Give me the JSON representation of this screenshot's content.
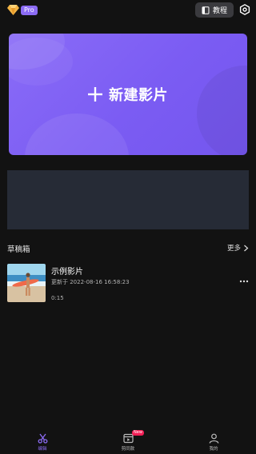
{
  "header": {
    "vip_badge": "Pro",
    "tutorial_label": "教程"
  },
  "create": {
    "label": "新建影片"
  },
  "drafts": {
    "section_title": "草稿箱",
    "more_label": "更多",
    "items": [
      {
        "title": "示例影片",
        "updated": "更新于 2022-08-16 16:58:23",
        "duration": "0:15"
      }
    ]
  },
  "tabbar": {
    "tabs": [
      {
        "label": "编辑",
        "icon": "scissors-icon",
        "active": true
      },
      {
        "label": "剪同款",
        "icon": "template-icon",
        "active": false
      },
      {
        "label": "我的",
        "icon": "user-icon",
        "active": false
      }
    ],
    "studio_badge": "New"
  },
  "colors": {
    "accent": "#8c6cf5",
    "background": "#121212",
    "badge": "#f21e55"
  }
}
